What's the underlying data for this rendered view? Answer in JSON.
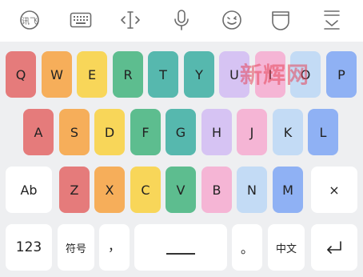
{
  "toolbar": {
    "items": [
      {
        "name": "iflytek-logo-icon",
        "label": "讯飞"
      },
      {
        "name": "keyboard-icon"
      },
      {
        "name": "text-cursor-icon"
      },
      {
        "name": "microphone-icon"
      },
      {
        "name": "emoji-icon"
      },
      {
        "name": "clipboard-icon"
      },
      {
        "name": "collapse-keyboard-icon"
      }
    ]
  },
  "watermark": "新辉网",
  "rows": {
    "row1": [
      "Q",
      "W",
      "E",
      "R",
      "T",
      "Y",
      "U",
      "I",
      "O",
      "P"
    ],
    "row2": [
      "A",
      "S",
      "D",
      "F",
      "G",
      "H",
      "J",
      "K",
      "L"
    ],
    "row3": [
      "Ab",
      "Z",
      "X",
      "C",
      "V",
      "B",
      "N",
      "M",
      "×"
    ],
    "row4": {
      "numbers": "123",
      "symbols": "符号",
      "comma": "，",
      "period": "。",
      "lang": "中文"
    }
  },
  "colors": {
    "red": "#e57b7b",
    "orange": "#f6ae5a",
    "yellow": "#f8d659",
    "green": "#5dbd8f",
    "teal": "#56b8ae",
    "purple": "#d6c3f3",
    "pink": "#f5b5d5",
    "lightblue": "#c3dbf5",
    "blue": "#8fb1f4"
  }
}
